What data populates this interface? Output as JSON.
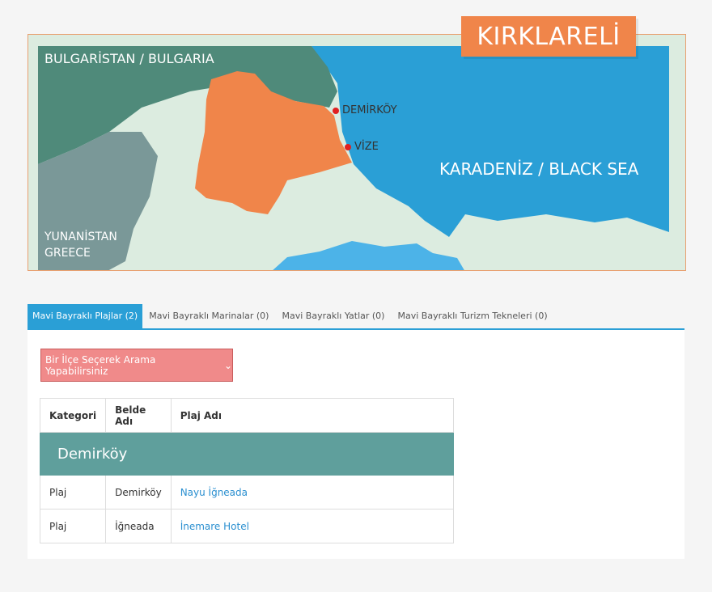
{
  "map": {
    "title": "KIRKLARELİ",
    "labels": {
      "bulgaria": "BULGARİSTAN / BULGARIA",
      "greece_line1": "YUNANİSTAN",
      "greece_line2": "GREECE",
      "black_sea": "KARADENİZ / BLACK SEA"
    },
    "cities": [
      "DEMİRKÖY",
      "VİZE"
    ],
    "colors": {
      "province": "#f0854a",
      "sea": "#2a9fd6",
      "bulgaria": "#4f8a7a",
      "greece": "#7a9898",
      "land": "#dcece0"
    }
  },
  "tabs": [
    {
      "label": "Mavi Bayraklı Plajlar (2)",
      "active": true
    },
    {
      "label": "Mavi Bayraklı Marinalar (0)",
      "active": false
    },
    {
      "label": "Mavi Bayraklı Yatlar (0)",
      "active": false
    },
    {
      "label": "Mavi Bayraklı Turizm Tekneleri (0)",
      "active": false
    }
  ],
  "search": {
    "label": "Bir İlçe Seçerek Arama Yapabilirsiniz",
    "chevron": "❯"
  },
  "table": {
    "headers": [
      "Kategori",
      "Belde Adı",
      "Plaj Adı"
    ],
    "group": "Demirköy",
    "rows": [
      {
        "category": "Plaj",
        "town": "Demirköy",
        "beach": "Nayu İğneada"
      },
      {
        "category": "Plaj",
        "town": "İğneada",
        "beach": "İnemare Hotel"
      }
    ]
  }
}
